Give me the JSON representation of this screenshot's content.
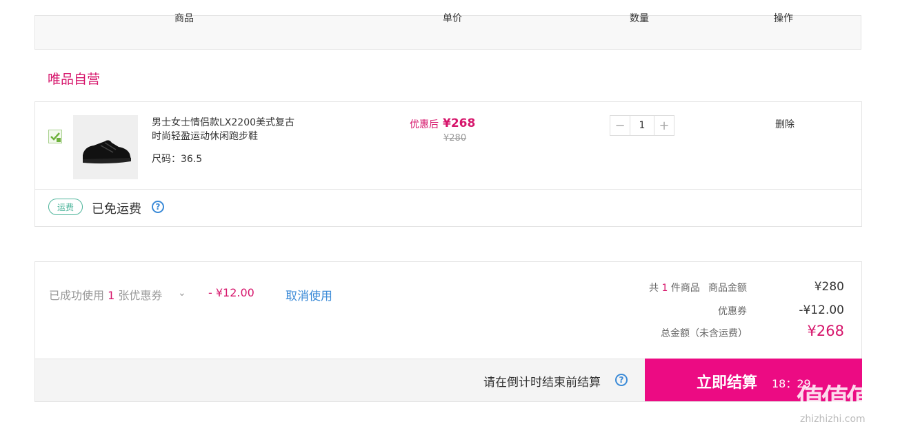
{
  "header": {
    "col_product": "商品",
    "col_price": "单价",
    "col_qty": "数量",
    "col_action": "操作"
  },
  "store": {
    "title": "唯品自营"
  },
  "item": {
    "name_line1": "男士女士情侣款LX2200美式复古",
    "name_line2": "时尚轻盈运动休闲跑步鞋",
    "size": "尺码：36.5",
    "price_after_label": "优惠后",
    "price_after": "¥268",
    "price_original": "¥280",
    "quantity": "1",
    "minus": "−",
    "plus": "+",
    "delete_label": "删除",
    "checked": true
  },
  "shipping": {
    "badge": "运费",
    "text": "已免运费",
    "help": "?"
  },
  "coupon": {
    "prefix": "已成功使用",
    "count": "1",
    "suffix": "张优惠券",
    "chevron": "⌄",
    "amount": "- ¥12.00",
    "cancel_label": "取消使用"
  },
  "summary": {
    "count_prefix": "共",
    "count": "1",
    "count_suffix": "件商品",
    "goods_label": "商品金额",
    "goods_value": "¥280",
    "coupon_label": "优惠券",
    "coupon_value": "-¥12.00",
    "total_label": "总金额（未含运费）",
    "total_value": "¥268"
  },
  "checkout": {
    "countdown_text": "请在倒计时结束前结算",
    "help": "?",
    "button_label": "立即结算",
    "timer": "18：29"
  },
  "watermark": {
    "logo": "值值值",
    "url": "zhizhizhi.com"
  },
  "colors": {
    "accent": "#d6156b",
    "checkout_bg": "#ec0b83",
    "link": "#3a8ad7",
    "shipping_green": "#4cb49a"
  }
}
